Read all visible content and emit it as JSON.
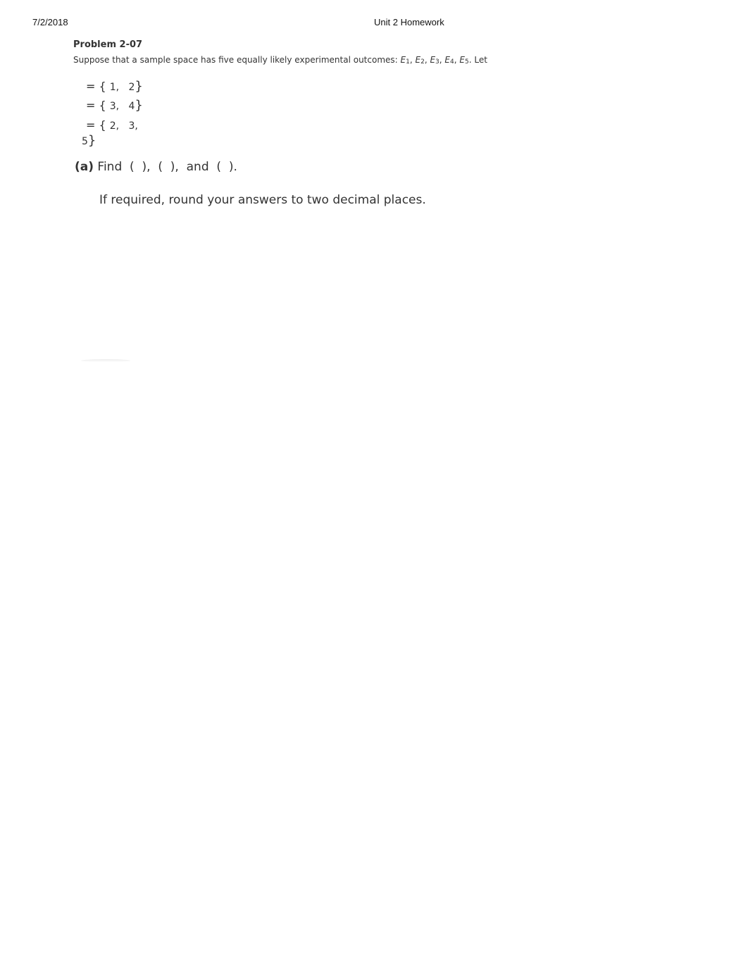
{
  "header": {
    "date": "7/2/2018",
    "title": "Unit 2 Homework"
  },
  "problem": {
    "title": "Problem 2-07",
    "intro_prefix": "Suppose that a sample space has five equally likely experimental outcomes: ",
    "outcomes": [
      "1",
      "2",
      "3",
      "4",
      "5"
    ],
    "outcome_letter": "E",
    "intro_suffix": ". Let",
    "sets": [
      {
        "eq": "= {",
        "members": "1,   2",
        "close": "}"
      },
      {
        "eq": "= {",
        "members": "3,   4",
        "close": "}"
      },
      {
        "eq": "= {",
        "members": "2,   3,",
        "close": ""
      }
    ],
    "set_continuation": {
      "members": "5",
      "close": "}"
    },
    "part_a": {
      "label": "(a)",
      "text": " Find  (  ),  (  ),  and  (  )."
    },
    "instruction": "If required, round your answers to two decimal places."
  }
}
